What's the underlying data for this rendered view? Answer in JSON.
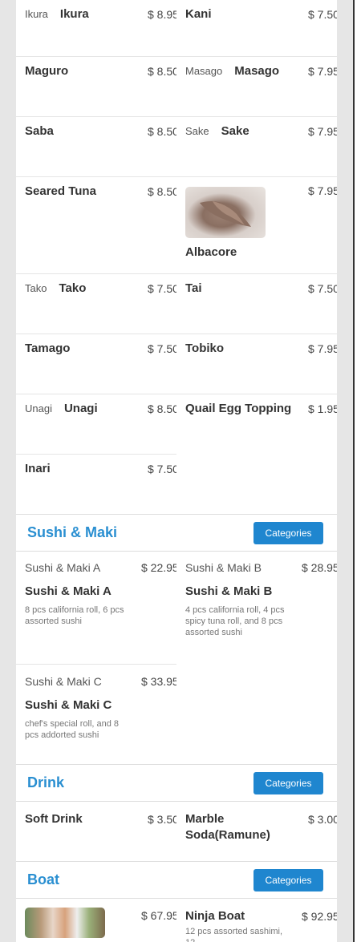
{
  "menu_top": [
    {
      "name": "Ikura",
      "price": "$ 8.95",
      "alt": "Ikura"
    },
    {
      "name": "Kani",
      "price": "$ 7.50"
    },
    {
      "name": "Maguro",
      "price": "$ 8.50"
    },
    {
      "name": "Masago",
      "price": "$ 7.95",
      "alt": "Masago"
    },
    {
      "name": "Saba",
      "price": "$ 8.50"
    },
    {
      "name": "Sake",
      "price": "$ 7.95",
      "alt": "Sake"
    },
    {
      "name": "Seared Tuna",
      "price": "$ 8.50"
    },
    {
      "name": "Albacore",
      "price": "$ 7.95"
    },
    {
      "name": "Tako",
      "price": "$ 7.50",
      "alt": "Tako"
    },
    {
      "name": "Tai",
      "price": "$ 7.50"
    },
    {
      "name": "Tamago",
      "price": "$ 7.50"
    },
    {
      "name": "Tobiko",
      "price": "$ 7.95"
    },
    {
      "name": "Unagi",
      "price": "$ 8.50",
      "alt": "Unagi"
    },
    {
      "name": "Quail Egg Topping",
      "price": "$ 1.95"
    },
    {
      "name": "Inari",
      "price": "$ 7.50"
    }
  ],
  "sections": {
    "sushi_maki": {
      "title": "Sushi & Maki",
      "button": "Categories",
      "items": [
        {
          "name": "Sushi & Maki A",
          "price": "$ 22.95",
          "alt": "Sushi & Maki A",
          "desc": "8 pcs california roll, 6 pcs assorted sushi"
        },
        {
          "name": "Sushi & Maki B",
          "price": "$ 28.95",
          "alt": "Sushi & Maki B",
          "desc": "4 pcs california roll, 4 pcs spicy tuna roll, and 8 pcs assorted sushi"
        },
        {
          "name": "Sushi & Maki C",
          "price": "$ 33.95",
          "alt": "Sushi & Maki C",
          "desc": "chef's special roll, and 8 pcs addorted sushi"
        }
      ]
    },
    "drink": {
      "title": "Drink",
      "button": "Categories",
      "items": [
        {
          "name": "Soft Drink",
          "price": "$ 3.50"
        },
        {
          "name": "Marble Soda(Ramune)",
          "price": "$ 3.00"
        }
      ]
    },
    "boat": {
      "title": "Boat",
      "button": "Categories",
      "items": [
        {
          "price": "$ 67.95"
        },
        {
          "name": "Ninja Boat",
          "price": "$ 92.95",
          "desc": "12 pcs assorted sashimi, 12"
        }
      ]
    }
  }
}
